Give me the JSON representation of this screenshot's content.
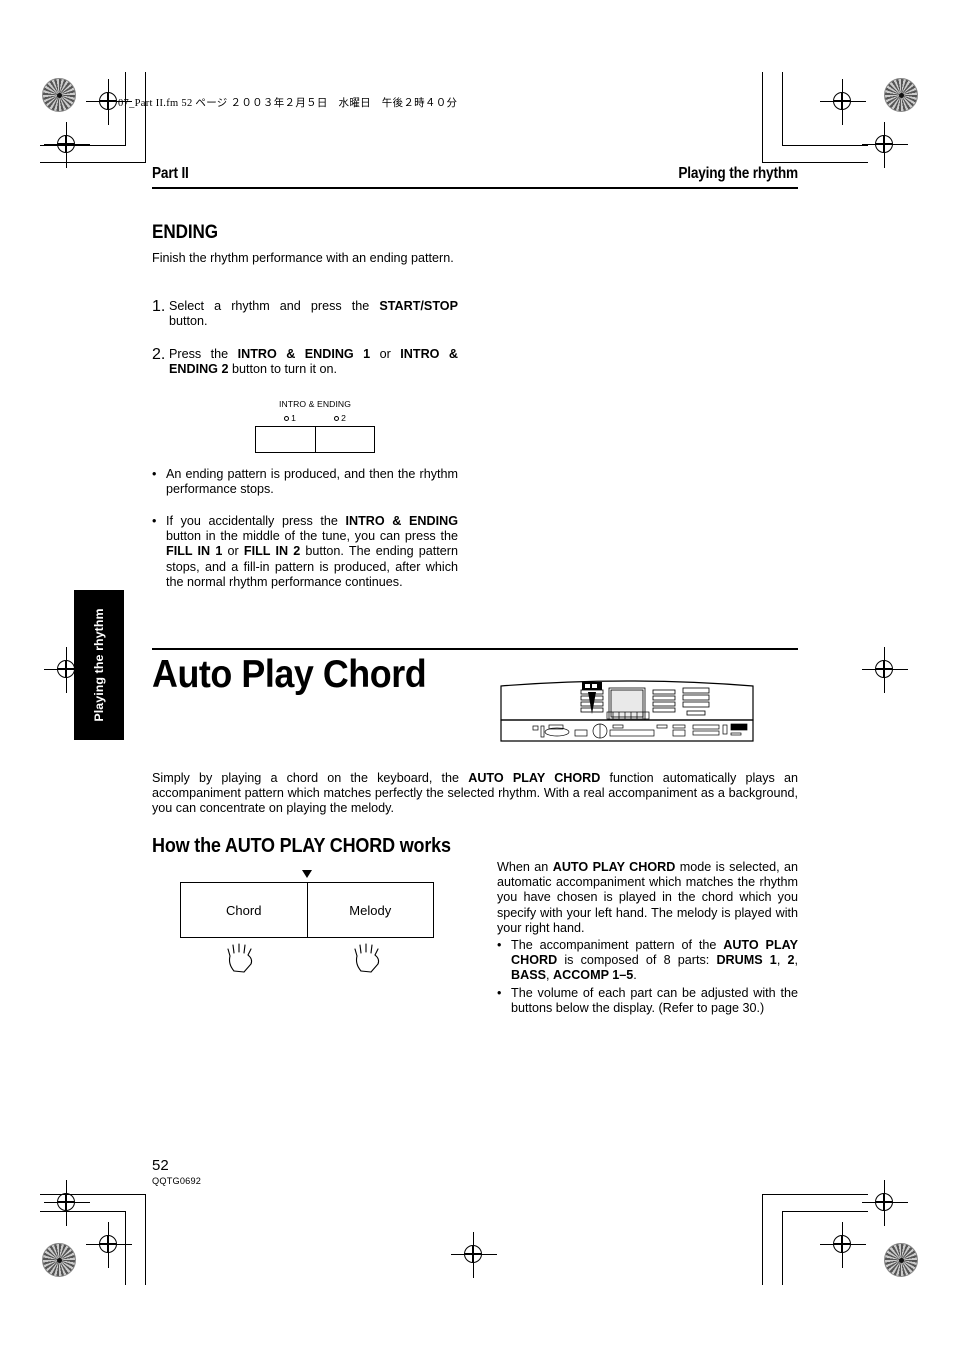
{
  "print_slug": "07_Part II.fm  52 ページ  ２００３年２月５日　水曜日　午後２時４０分",
  "running_head": {
    "left": "Part II",
    "right": "Playing the rhythm"
  },
  "side_tab": {
    "label": "Playing the rhythm"
  },
  "ending_section": {
    "heading": "ENDING",
    "intro": "Finish the rhythm performance with an ending pattern.",
    "steps": [
      {
        "number": "1.",
        "text_parts": [
          {
            "text": "Select a rhythm and press the ",
            "bold": false
          },
          {
            "text": "START/STOP",
            "bold": true
          },
          {
            "text": " button.",
            "bold": false
          }
        ]
      },
      {
        "number": "2.",
        "text_parts": [
          {
            "text": "Press the ",
            "bold": false
          },
          {
            "text": "INTRO & ENDING 1",
            "bold": true
          },
          {
            "text": " or ",
            "bold": false
          },
          {
            "text": "INTRO & ENDING 2",
            "bold": true
          },
          {
            "text": " button to turn it on.",
            "bold": false
          }
        ]
      }
    ],
    "figure": {
      "label": "INTRO & ENDING",
      "marks": [
        "1",
        "2"
      ]
    },
    "bullets": [
      {
        "dot": "•",
        "text_parts": [
          {
            "text": "An ending pattern is produced, and then the rhythm performance stops.",
            "bold": false
          }
        ]
      },
      {
        "dot": "•",
        "text_parts": [
          {
            "text": "If you accidentally press the ",
            "bold": false
          },
          {
            "text": "INTRO & ENDING",
            "bold": true
          },
          {
            "text": " button in the middle of the tune, you can press the ",
            "bold": false
          },
          {
            "text": "FILL IN 1",
            "bold": true
          },
          {
            "text": " or ",
            "bold": false
          },
          {
            "text": "FILL IN 2",
            "bold": true
          },
          {
            "text": " button. The ending pattern stops, and a fill-in pattern is produced, after which the normal rhythm performance continues.",
            "bold": false
          }
        ]
      }
    ]
  },
  "auto_play_chord": {
    "title": "Auto Play Chord",
    "intro_parts": [
      {
        "text": "Simply by playing a chord on the keyboard, the ",
        "bold": false
      },
      {
        "text": "AUTO PLAY CHORD",
        "bold": true
      },
      {
        "text": " function automatically plays an accompaniment pattern which matches perfectly the selected rhythm. With a real accompaniment as a background, you can concentrate on playing the melody.",
        "bold": false
      }
    ],
    "subheading": "How the AUTO PLAY CHORD works",
    "figure": {
      "left_label": "Chord",
      "right_label": "Melody",
      "split_marker": "split-point-arrow",
      "hand_icons": [
        "left-hand-icon",
        "right-hand-icon"
      ]
    },
    "right_column": {
      "paragraph_parts": [
        {
          "text": "When an ",
          "bold": false
        },
        {
          "text": "AUTO PLAY CHORD",
          "bold": true
        },
        {
          "text": " mode is selected, an automatic accompaniment which matches the rhythm you have chosen is played in the chord which you specify with your left hand. The melody is played with your right hand.",
          "bold": false
        }
      ],
      "bullets": [
        {
          "dot": "•",
          "text_parts": [
            {
              "text": "The accompaniment pattern of the ",
              "bold": false
            },
            {
              "text": "AUTO PLAY CHORD",
              "bold": true
            },
            {
              "text": " is composed of 8 parts: ",
              "bold": false
            },
            {
              "text": "DRUMS 1",
              "bold": true
            },
            {
              "text": ", ",
              "bold": false
            },
            {
              "text": "2",
              "bold": true
            },
            {
              "text": ", ",
              "bold": false
            },
            {
              "text": "BASS",
              "bold": true
            },
            {
              "text": ", ",
              "bold": false
            },
            {
              "text": "ACCOMP 1–5",
              "bold": true
            },
            {
              "text": ".",
              "bold": false
            }
          ]
        },
        {
          "dot": "•",
          "text_parts": [
            {
              "text": "The volume of each part can be adjusted with the buttons below the display. (Refer to page 30.)",
              "bold": false
            }
          ]
        }
      ]
    },
    "keyboard_illustration": "keyboard-control-panel-illustration"
  },
  "footer": {
    "page_number": "52",
    "doc_code": "QQTG0692"
  },
  "colors": {
    "ink": "#000000",
    "paper": "#ffffff"
  }
}
